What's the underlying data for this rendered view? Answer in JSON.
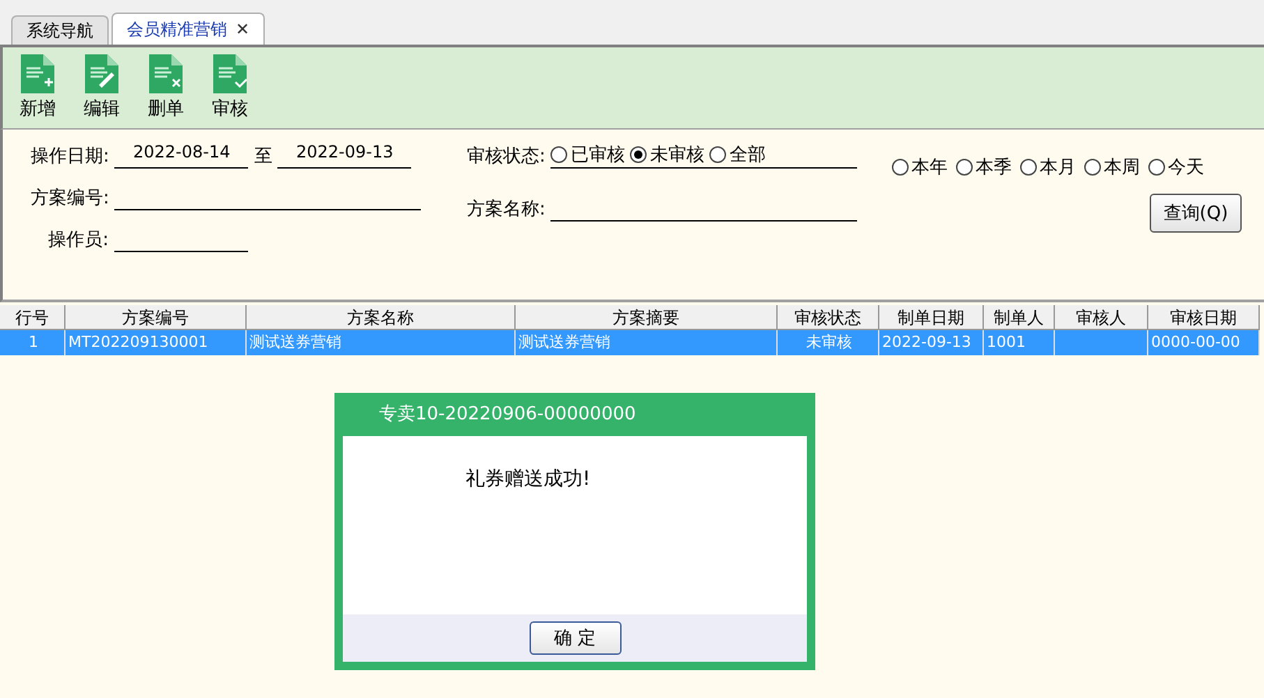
{
  "tabs": [
    {
      "label": "系统导航",
      "selected": false
    },
    {
      "label": "会员精准营销",
      "selected": true,
      "close": "✕"
    }
  ],
  "toolbar": [
    {
      "label": "新增",
      "kind": "add"
    },
    {
      "label": "编辑",
      "kind": "edit"
    },
    {
      "label": "删单",
      "kind": "delete"
    },
    {
      "label": "审核",
      "kind": "approve"
    }
  ],
  "filters": {
    "date_label": "操作日期:",
    "date_from": "2022-08-14",
    "date_sep": "至",
    "date_to": "2022-09-13",
    "plan_no_label": "方案编号:",
    "operator_label": "操作员:",
    "status_label": "审核状态:",
    "status_options": [
      {
        "label": "已审核",
        "selected": false
      },
      {
        "label": "未审核",
        "selected": true
      },
      {
        "label": "全部",
        "selected": false
      }
    ],
    "plan_name_label": "方案名称:",
    "periods": [
      {
        "label": "本年",
        "selected": false
      },
      {
        "label": "本季",
        "selected": false
      },
      {
        "label": "本月",
        "selected": false
      },
      {
        "label": "本周",
        "selected": false
      },
      {
        "label": "今天",
        "selected": false
      }
    ],
    "query_button": "查询(Q)"
  },
  "table": {
    "columns": [
      "行号",
      "方案编号",
      "方案名称",
      "方案摘要",
      "审核状态",
      "制单日期",
      "制单人",
      "审核人",
      "审核日期"
    ],
    "rows": [
      {
        "selected": true,
        "cells": [
          "1",
          "MT202209130001",
          "测试送券营销",
          "测试送券营销",
          "未审核",
          "2022-09-13",
          "1001",
          "",
          "0000-00-00"
        ]
      }
    ]
  },
  "dialog": {
    "title": "专卖10-20220906-00000000",
    "message": "礼券赠送成功!",
    "button": "确 定"
  }
}
